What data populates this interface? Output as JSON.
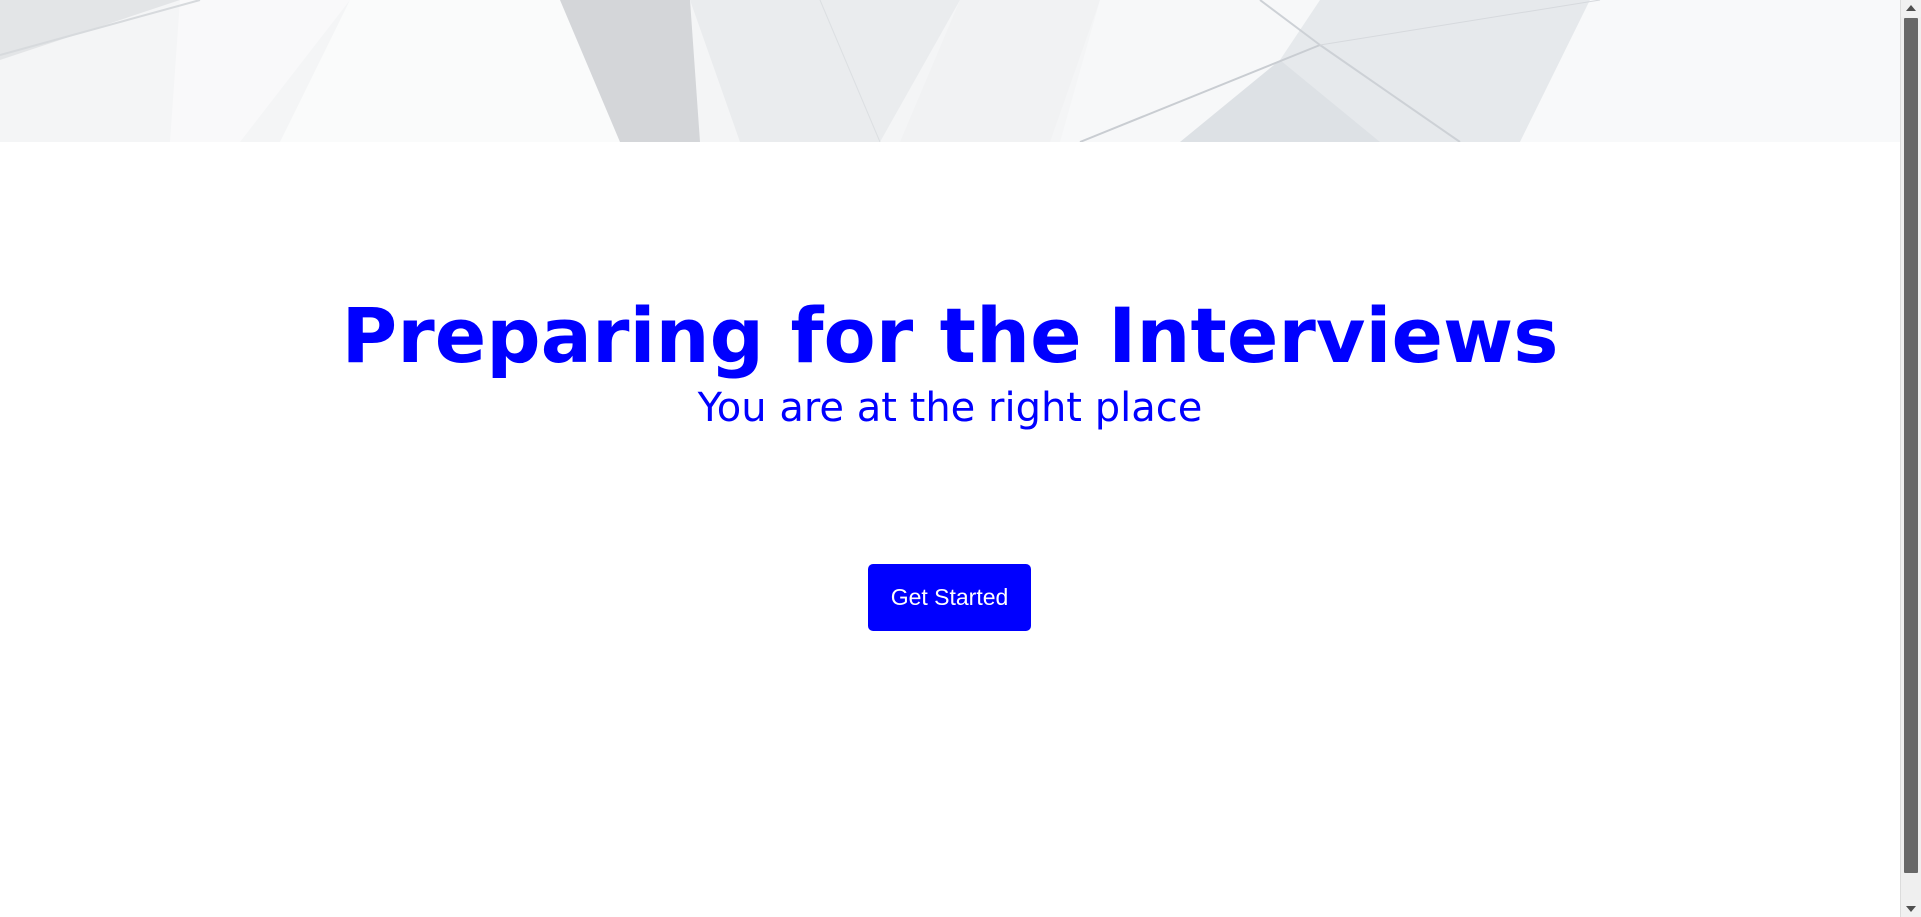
{
  "hero": {
    "title": "Preparing for the Interviews",
    "subtitle": "You are at the right place",
    "cta_label": "Get Started"
  },
  "colors": {
    "accent": "#0000ff",
    "button_text": "#ffffff",
    "background": "#ffffff",
    "banner": "#f3f4f5"
  },
  "banner": {
    "pattern": "light-grey-geometric-triangles"
  },
  "icons": {
    "scroll_up": "triangle-up",
    "scroll_down": "triangle-down"
  }
}
